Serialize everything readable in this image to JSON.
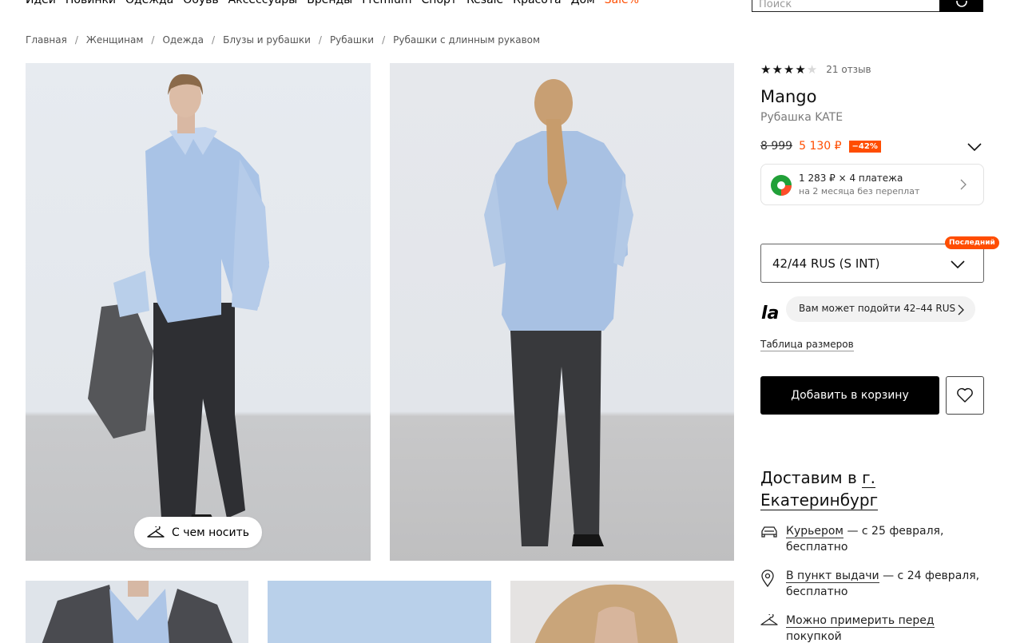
{
  "nav": {
    "items": [
      "Идеи",
      "Новинки",
      "Одежда",
      "Обувь",
      "Аксессуары",
      "Бренды",
      "Premium",
      "Спорт",
      "Resale",
      "Красота",
      "Дом"
    ],
    "sale": "Sale%"
  },
  "search": {
    "placeholder": "Поиск"
  },
  "breadcrumbs": [
    "Главная",
    "Женщинам",
    "Одежда",
    "Блузы и рубашки",
    "Рубашки",
    "Рубашки с длинным рукавом"
  ],
  "gallery": {
    "wear_button": "С чем носить"
  },
  "product": {
    "rating": 4,
    "rating_max": 5,
    "reviews": "21 отзыв",
    "brand": "Mango",
    "name": "Рубашка KATE",
    "old_price": "8 999",
    "new_price": "5 130 ₽",
    "discount": "−42%"
  },
  "installment": {
    "line1": "1 283 ₽ × 4 платежа",
    "line2": "на 2 месяца без переплат"
  },
  "size": {
    "selected": "42/44 RUS (S INT)",
    "badge": "Последний",
    "fit_logo": "la",
    "fit_hint": "Вам может подойти 42–44 RUS",
    "table_link": "Таблица размеров"
  },
  "actions": {
    "add_to_cart": "Добавить в корзину"
  },
  "delivery": {
    "title_prefix": "Доставим в",
    "city": "г. Екатеринбург",
    "courier_link": "Курьером",
    "courier_text": " — с 25 февраля, бесплатно",
    "pickup_link": "В пункт выдачи",
    "pickup_text": " — с 24 февраля, бесплатно",
    "tryon_link": "Можно примерить перед покупкой"
  },
  "colors": {
    "accent": "#ff4d00",
    "primary": "#000000"
  }
}
